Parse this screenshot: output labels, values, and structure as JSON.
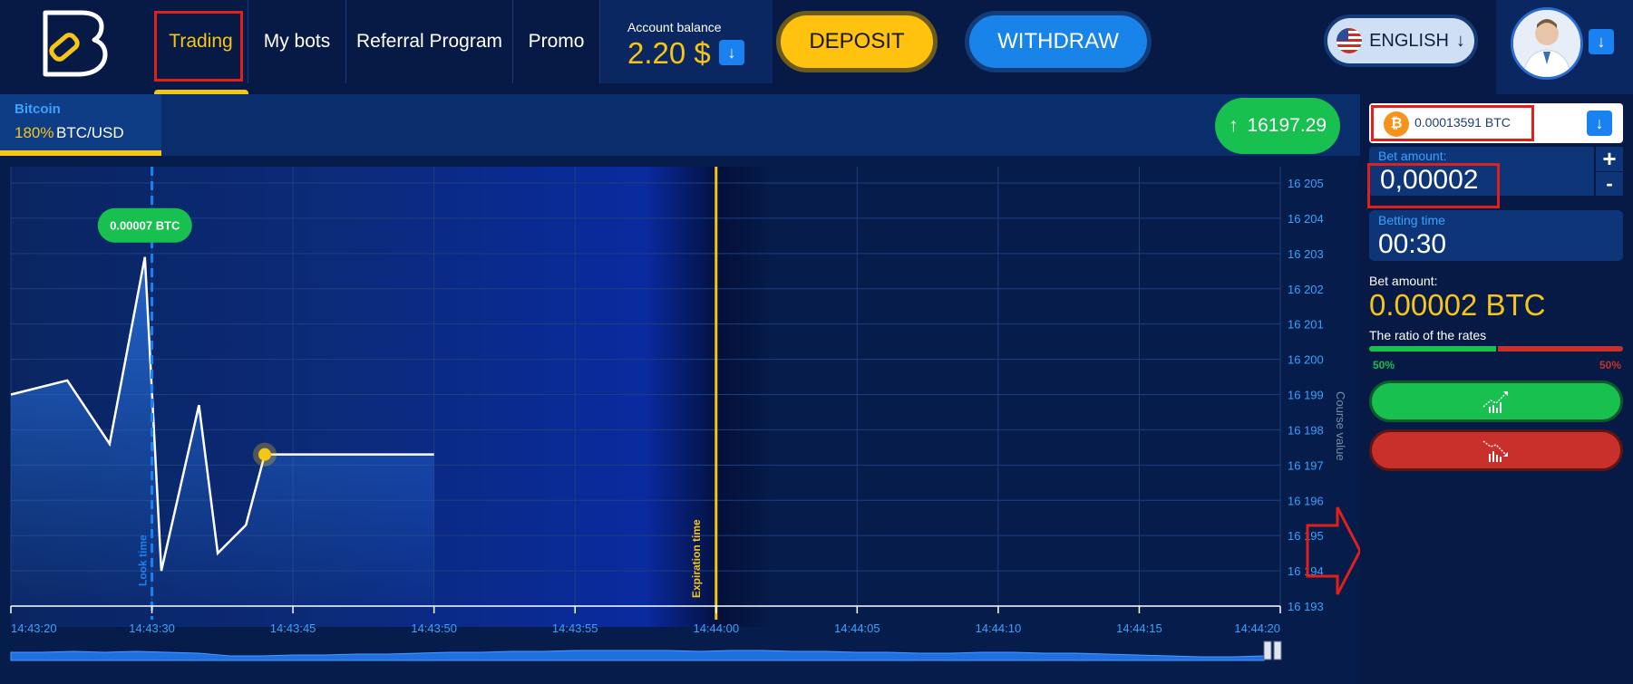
{
  "nav": {
    "items": [
      {
        "label": "Trading",
        "active": true
      },
      {
        "label": "My bots",
        "active": false
      },
      {
        "label": "Referral Program",
        "active": false
      },
      {
        "label": "Promo",
        "active": false
      }
    ]
  },
  "account": {
    "balance_label": "Account balance",
    "balance_value": "2.20 $",
    "deposit_label": "DEPOSIT",
    "withdraw_label": "WITHDRAW"
  },
  "language": {
    "label": "ENGLISH"
  },
  "asset": {
    "name": "Bitcoin",
    "payout": "180%",
    "pair": "BTC/USD",
    "current_price": "16197.29"
  },
  "chart_data": {
    "type": "area",
    "x": [
      "14:43:20",
      "14:43:24",
      "14:43:27",
      "14:43:29.5",
      "14:43:31",
      "14:43:35",
      "14:43:37",
      "14:43:40",
      "14:43:42",
      "14:43:50"
    ],
    "values": [
      16199.0,
      16199.4,
      16197.6,
      16202.9,
      16194.0,
      16198.7,
      16194.5,
      16195.3,
      16197.3,
      16197.3
    ],
    "x_ticks": [
      "14:43:20",
      "14:43:30",
      "14:43:45",
      "14:43:50",
      "14:43:55",
      "14:44:00",
      "14:44:05",
      "14:44:10",
      "14:44:15",
      "14:44:20"
    ],
    "y_ticks": [
      "16 205",
      "16 204",
      "16 203",
      "16 202",
      "16 201",
      "16 200",
      "16 199",
      "16 198",
      "16 197",
      "16 196",
      "16 195",
      "16 194",
      "16 193"
    ],
    "ylim": [
      16193,
      16205
    ],
    "annotations": {
      "peak_label": "0.00007 BTC",
      "look_time": "Look time",
      "expiration_time": "Expiration time",
      "course_value": "Course value"
    },
    "colors": {
      "line": "#ffffff",
      "fill": "#1f6fe0",
      "look_time": "#1a82f0",
      "expiration": "#f5c518",
      "marker": "#f5c518"
    }
  },
  "panel": {
    "wallet_value": "0.00013591 BTC",
    "bet_label": "Bet amount:",
    "bet_value": "0,00002",
    "plus": "+",
    "minus": "-",
    "time_label": "Betting time",
    "time_value": "00:30",
    "bet_sum_label": "Bet amount:",
    "bet_sum_value": "0.00002 BTC",
    "ratio_label": "The ratio of the rates",
    "ratio_up": "50%",
    "ratio_down": "50%"
  },
  "colors": {
    "accent": "#f5c518",
    "brand_blue": "#1a82f0",
    "up": "#17c04f",
    "down": "#c9302c",
    "annotation": "#e0201c"
  }
}
